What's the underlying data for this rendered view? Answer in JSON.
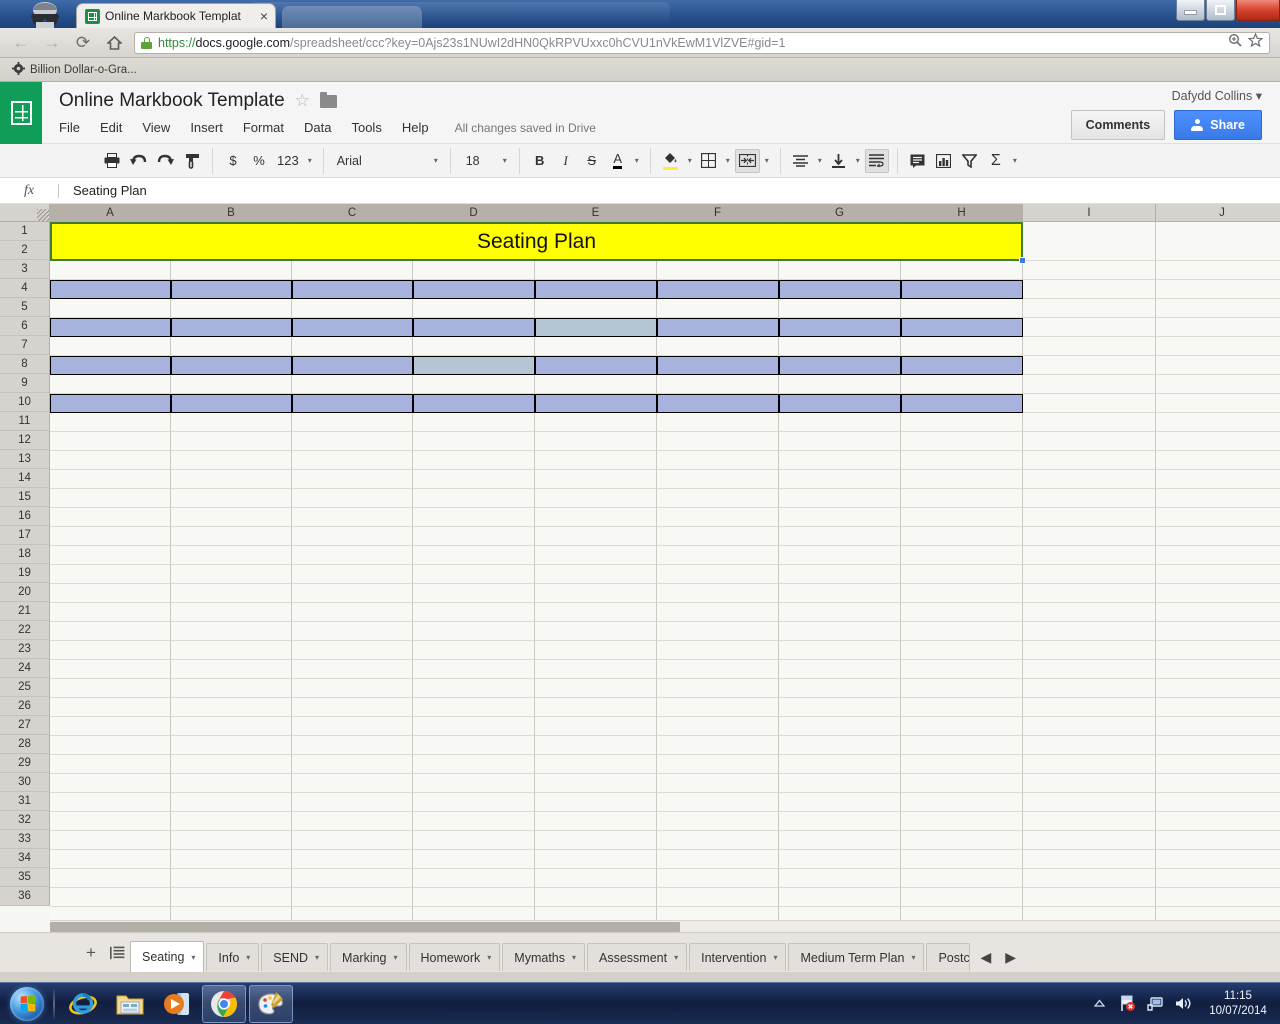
{
  "browser": {
    "tab_title": "Online Markbook Templat",
    "tab_close": "×",
    "back_icon": "←",
    "forward_icon": "→",
    "reload_icon": "⟳",
    "home_icon": "⌂",
    "url_scheme": "https://",
    "url_host": "docs.google.com",
    "url_path": "/spreadsheet/ccc?key=0Ajs23s1NUwI2dHN0QkRPVUxxc0hCVU1nVkEwM1VlZVE#gid=1",
    "zoom_icon": "⊕",
    "bookmark_star": "☆",
    "bookmarks": [
      {
        "label": "Billion Dollar-o-Gra...",
        "icon": "gear-icon"
      }
    ],
    "window_controls": {
      "minimize": "minimize",
      "maximize": "restore",
      "close": "close"
    }
  },
  "sheets": {
    "doc_title": "Online Markbook Template",
    "star": "☆",
    "menus": [
      "File",
      "Edit",
      "View",
      "Insert",
      "Format",
      "Data",
      "Tools",
      "Help"
    ],
    "save_status": "All changes saved in Drive",
    "account_name": "Dafydd Collins",
    "account_caret": "▾",
    "comments_label": "Comments",
    "share_label": "Share",
    "toolbar": {
      "print": "⎙",
      "undo": "↶",
      "redo": "↷",
      "paint_format": "὘C",
      "currency": "$",
      "percent": "%",
      "number_format": "123",
      "font": "Arial",
      "font_size": "18",
      "bold": "B",
      "italic": "I",
      "strikethrough": "S",
      "text_color": "A",
      "fill_color": "◢",
      "borders": "⊞",
      "merge_cells": "⇥⇤",
      "align": "≡",
      "valign": "⤓",
      "wrap": "↩",
      "comment": "▤",
      "chart": "Ὄa",
      "filter": "▽",
      "functions": "Σ",
      "caret": "▾"
    },
    "formula_bar": {
      "fx": "fx",
      "value": "Seating Plan"
    },
    "grid": {
      "columns": [
        "A",
        "B",
        "C",
        "D",
        "E",
        "F",
        "G",
        "H",
        "I",
        "J"
      ],
      "selected_columns": [
        "A",
        "B",
        "C",
        "D",
        "E",
        "F",
        "G",
        "H"
      ],
      "rows": [
        1,
        2,
        3,
        4,
        5,
        6,
        7,
        8,
        9,
        10,
        11,
        12,
        13,
        14,
        15,
        16,
        17,
        18,
        19,
        20,
        21,
        22,
        23,
        24,
        25,
        26,
        27,
        28,
        29,
        30,
        31,
        32,
        33,
        34,
        35,
        36
      ],
      "merged_title": {
        "text": "Seating Plan",
        "range": "A1:H1",
        "fill": "#ffff00",
        "selected": true
      },
      "seat_rows": [
        3,
        5,
        7,
        9
      ],
      "seat_fill": "#a7b3dd",
      "seat_fill_alt": "#b6c5d3",
      "alt_shaded_cells": [
        "E5",
        "D7"
      ]
    },
    "sheet_tabs": [
      {
        "label": "Seating",
        "active": true
      },
      {
        "label": "Info",
        "active": false
      },
      {
        "label": "SEND",
        "active": false
      },
      {
        "label": "Marking",
        "active": false
      },
      {
        "label": "Homework",
        "active": false
      },
      {
        "label": "Mymaths",
        "active": false
      },
      {
        "label": "Assessment",
        "active": false
      },
      {
        "label": "Intervention",
        "active": false
      },
      {
        "label": "Medium Term Plan",
        "active": false
      },
      {
        "label": "Postc",
        "active": false,
        "clipped": true
      }
    ],
    "sheet_tab_tools": {
      "add": "+",
      "all_sheets": "≡"
    },
    "sheet_nav": {
      "prev": "◀",
      "next": "▶"
    }
  },
  "taskbar": {
    "start": "start-orb",
    "items": [
      {
        "name": "internet-explorer",
        "running": false
      },
      {
        "name": "windows-explorer",
        "running": false
      },
      {
        "name": "windows-media-player",
        "running": false
      },
      {
        "name": "google-chrome",
        "running": true
      },
      {
        "name": "microsoft-paint",
        "running": true
      }
    ],
    "tray": {
      "show_hidden": "▲",
      "icons": [
        "action-center-flag-icon",
        "network-icon",
        "volume-icon"
      ],
      "time": "11:15",
      "date": "10/07/2014"
    }
  },
  "colors": {
    "sheets_green": "#0f9d58",
    "share_blue": "#4d90fe",
    "title_yellow": "#ffff00",
    "seat_blue": "#a7b3dd",
    "seat_blue_alt": "#b6c5d3",
    "selection_border": "#3d7a33"
  }
}
